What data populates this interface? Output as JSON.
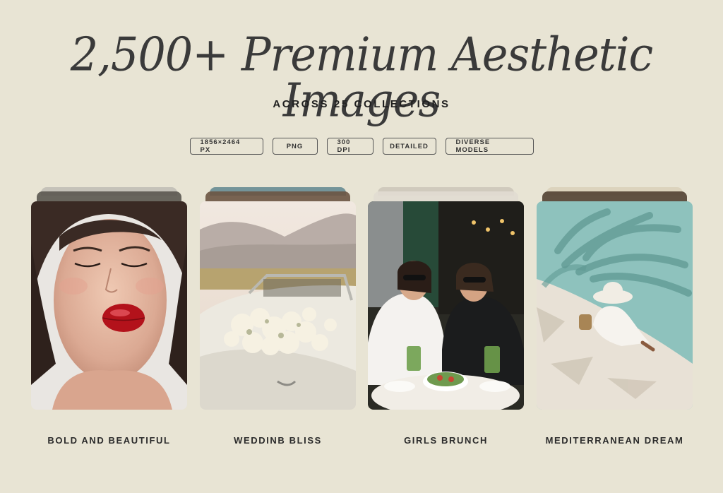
{
  "header": {
    "title": "2,500+ Premium Aesthetic Images",
    "subtitle": "ACROSS 25 COLLECTIONS"
  },
  "badges": [
    "1856×2464 PX",
    "PNG",
    "300 DPI",
    "DETAILED",
    "DIVERSE MODELS"
  ],
  "collections": [
    {
      "label": "BOLD AND BEAUTIFUL",
      "image": "portrait-red-lips-image"
    },
    {
      "label": "WEDDINB BLISS",
      "image": "vintage-car-flowers-image"
    },
    {
      "label": "GIRLS BRUNCH",
      "image": "cafe-brunch-friends-image"
    },
    {
      "label": "MEDITERRANEAN DREAM",
      "image": "poolside-palm-shadow-image"
    }
  ],
  "colors": {
    "background": "#e8e4d4",
    "text": "#2d2d2d",
    "badge_border": "#555555"
  }
}
